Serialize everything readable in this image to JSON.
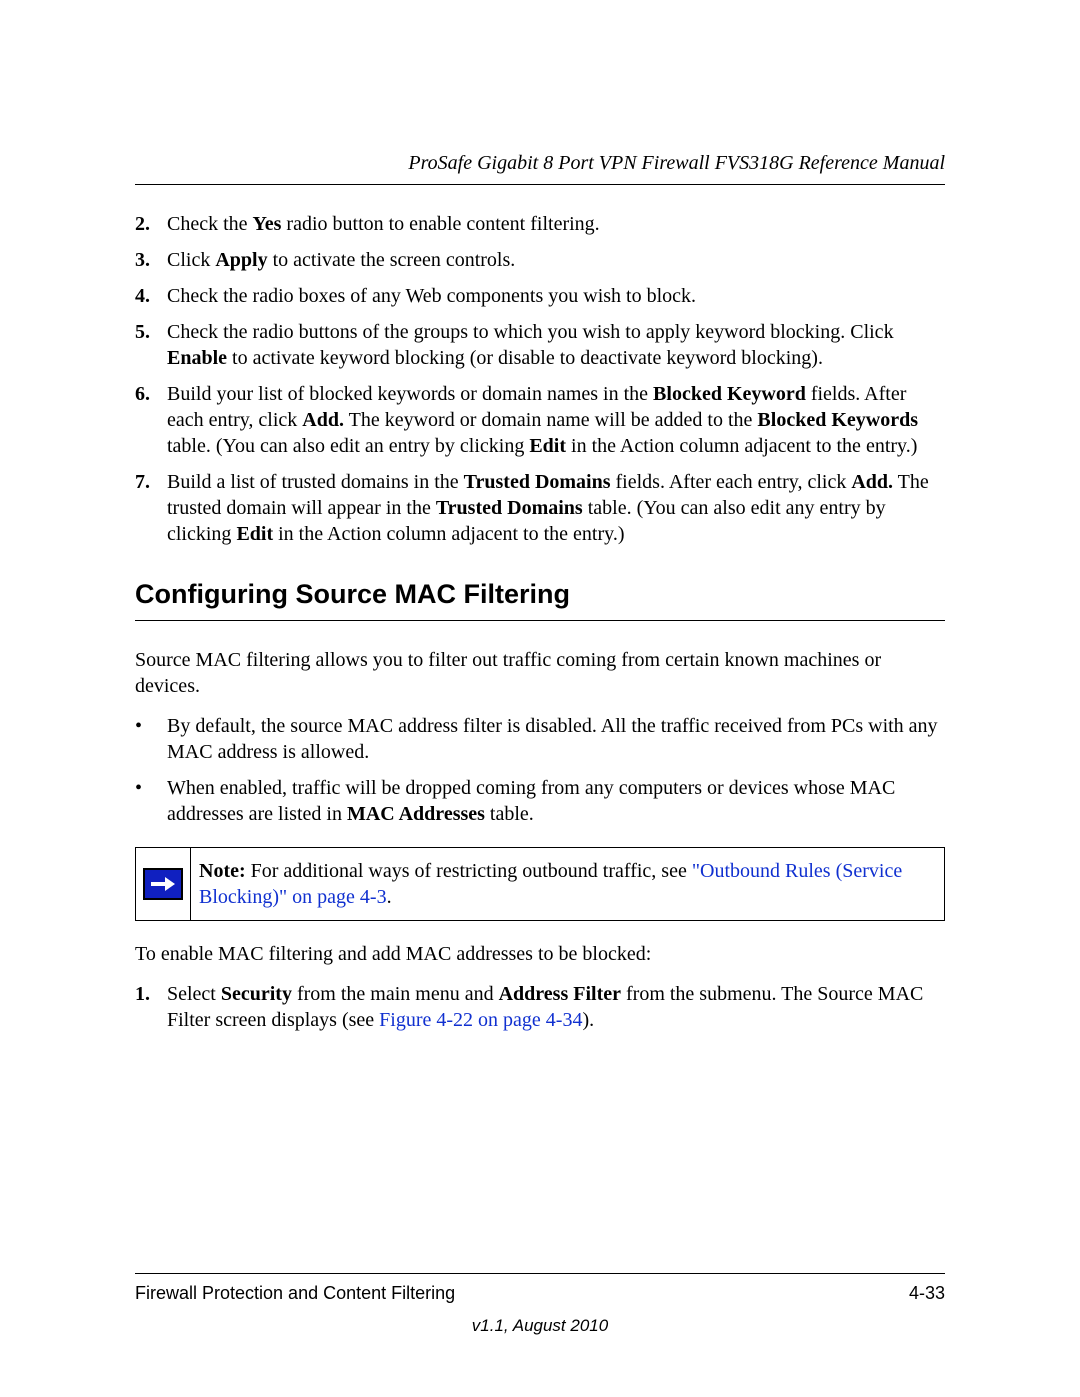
{
  "header": {
    "title": "ProSafe Gigabit 8 Port VPN Firewall FVS318G Reference Manual"
  },
  "steps": [
    {
      "num": "2.",
      "html": "Check the <b>Yes</b> radio button to enable content filtering."
    },
    {
      "num": "3.",
      "html": "Click <b>Apply</b> to activate the screen controls."
    },
    {
      "num": "4.",
      "html": "Check the radio boxes of any Web components you wish to block."
    },
    {
      "num": "5.",
      "html": "Check the radio buttons of the groups to which you wish to apply keyword blocking. Click <b>Enable</b> to activate keyword blocking (or disable to deactivate keyword blocking)."
    },
    {
      "num": "6.",
      "html": "Build your list of blocked keywords or domain names in the <b>Blocked Keyword</b> fields. After each entry, click <b>Add.</b> The keyword or domain name will be added to the <b>Blocked Keywords</b> table. (You can also edit an entry by clicking <b>Edit</b> in the Action column adjacent to the entry.)"
    },
    {
      "num": "7.",
      "html": "Build a list of trusted domains in the <b>Trusted Domains</b> fields. After each entry, click <b>Add.</b> The trusted domain will appear in the <b>Trusted Domains</b> table. (You can also edit any entry by clicking <b>Edit</b> in the Action column adjacent to the entry.)"
    }
  ],
  "section_heading": "Configuring Source MAC Filtering",
  "intro": "Source MAC filtering allows you to filter out traffic coming from certain known machines or devices.",
  "bullets": [
    {
      "html": "By default, the source MAC address filter is disabled. All the traffic received from PCs with any MAC address is allowed."
    },
    {
      "html": "When enabled, traffic will be dropped coming from any computers or devices whose MAC addresses are listed in <b>MAC Addresses</b> table."
    }
  ],
  "note": {
    "prefix": "Note:",
    "body_before_link": " For additional ways of restricting outbound traffic, see ",
    "link_text": "\"Outbound Rules (Service Blocking)\" on page 4-3",
    "body_after_link": "."
  },
  "enable_intro": "To enable MAC filtering and add MAC addresses to be blocked:",
  "enable_steps": [
    {
      "num": "1.",
      "html_before_link": "Select <b>Security</b> from the main menu and <b>Address Filter</b> from the submenu. The Source MAC Filter screen displays (see ",
      "link_text": "Figure 4-22 on page 4-34",
      "html_after_link": ")."
    }
  ],
  "footer": {
    "left": "Firewall Protection and Content Filtering",
    "right": "4-33",
    "version": "v1.1, August 2010"
  }
}
